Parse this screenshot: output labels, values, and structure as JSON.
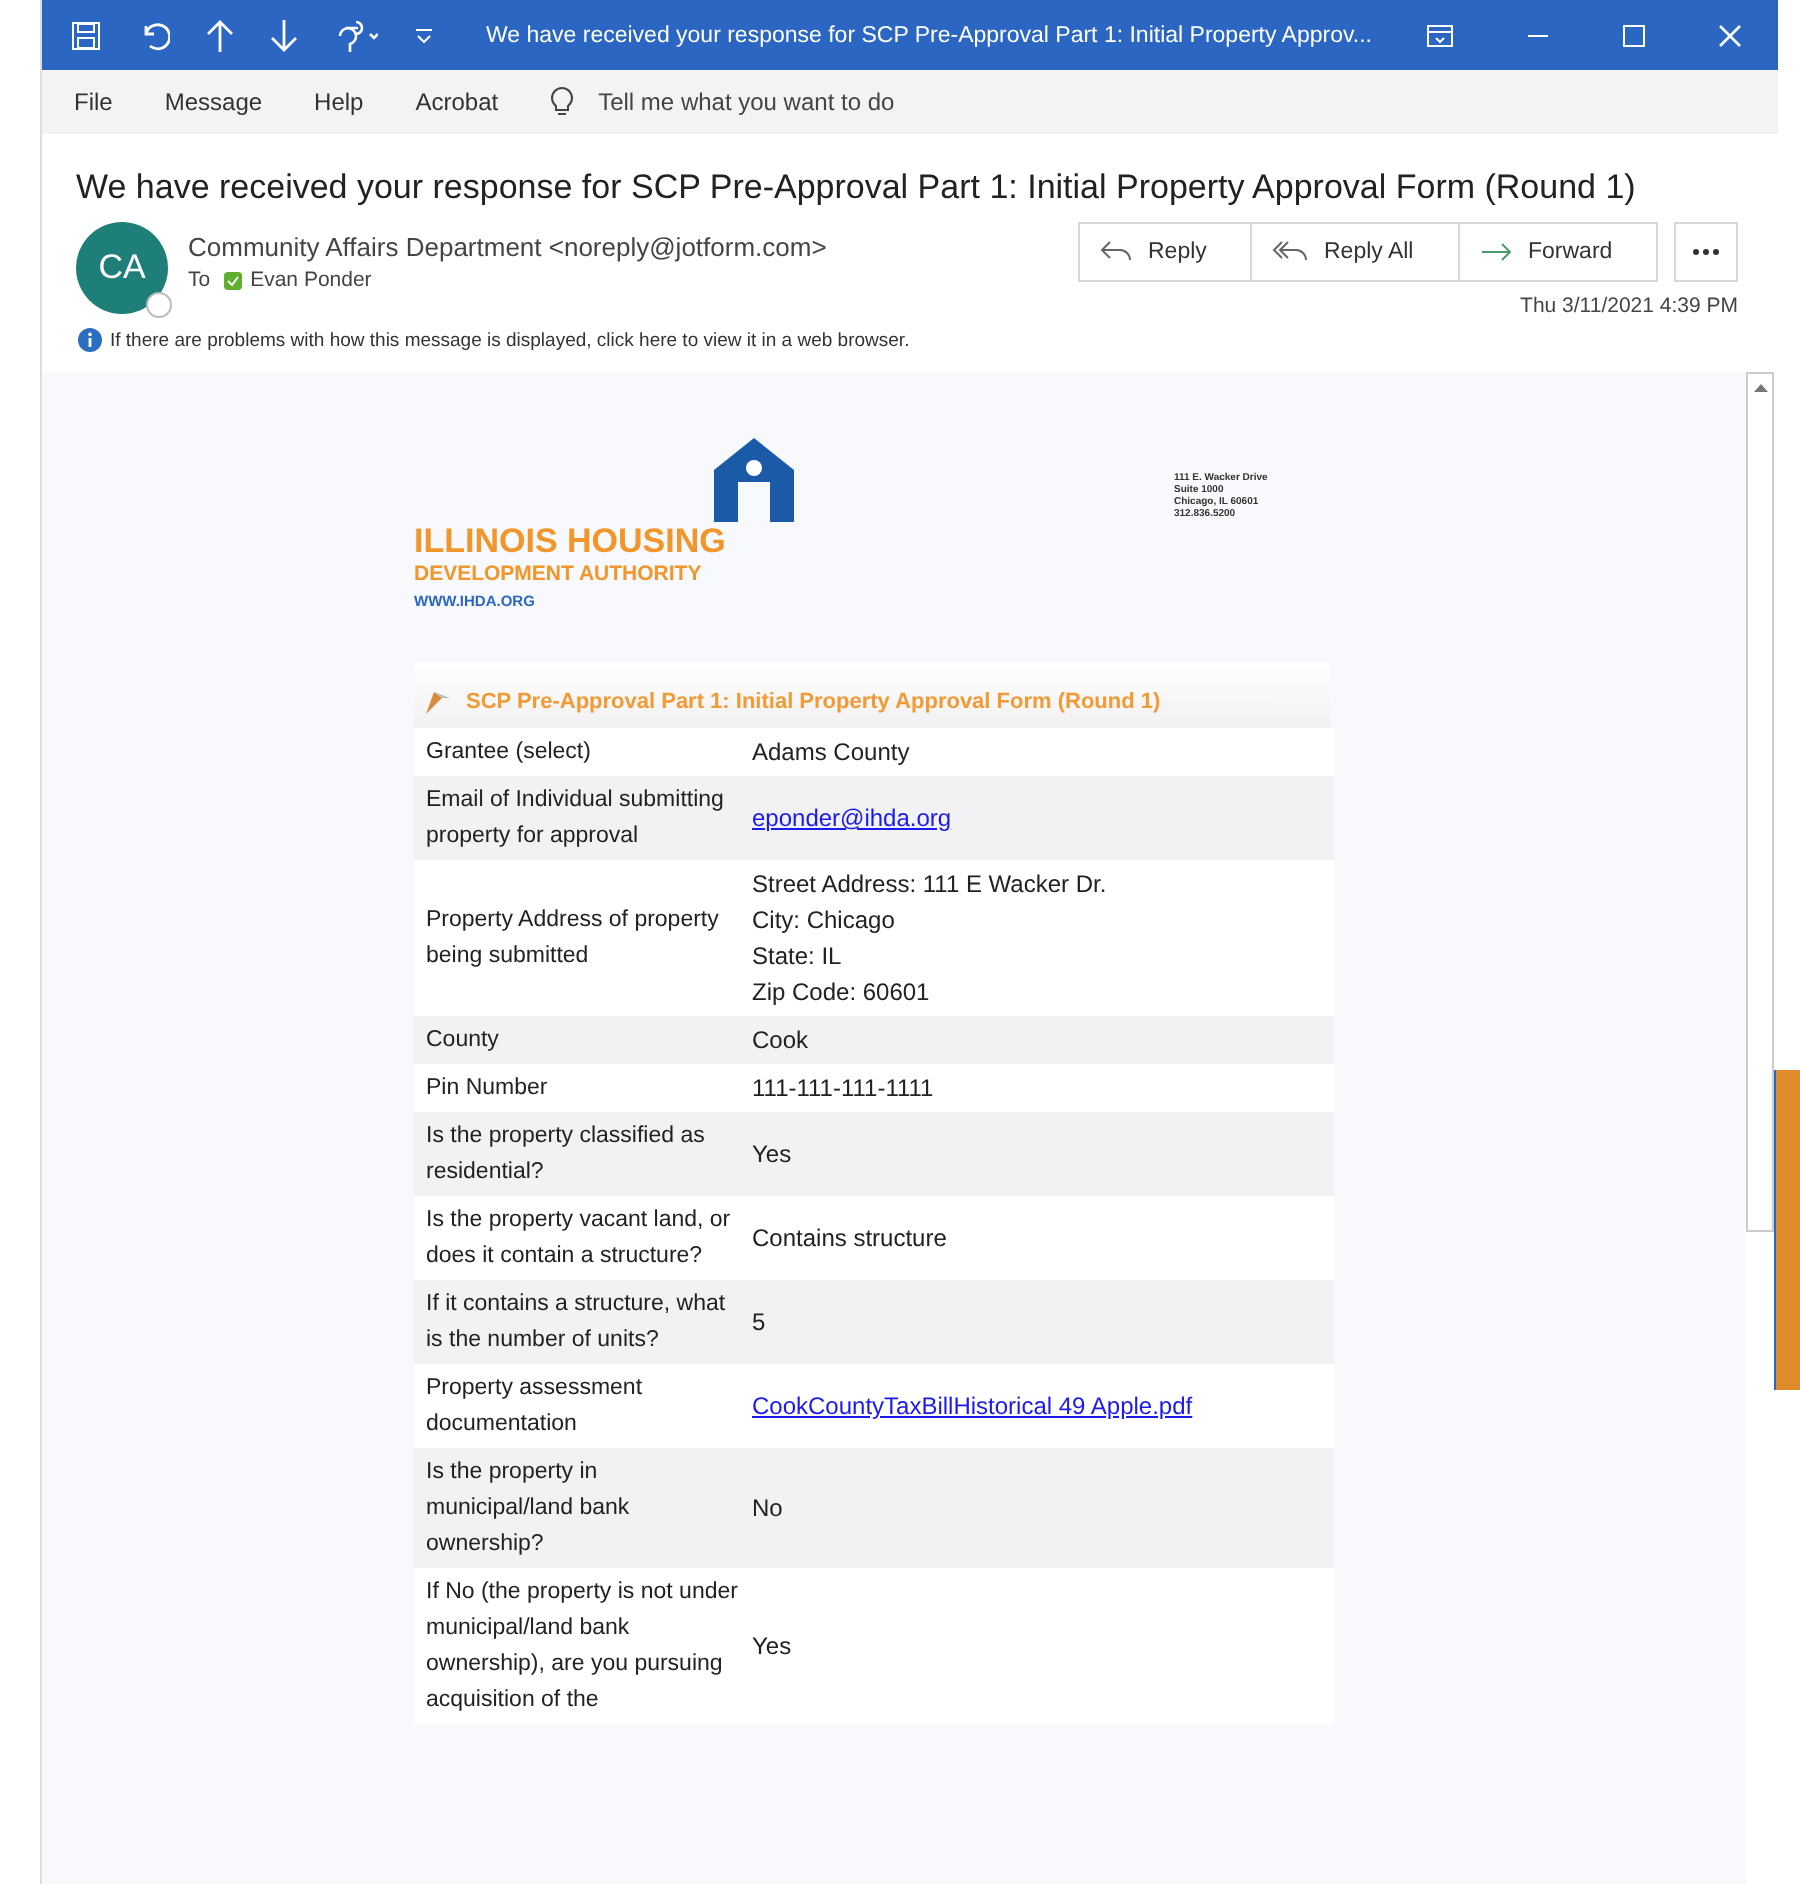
{
  "window": {
    "title": "We have received your response for SCP Pre-Approval Part 1: Initial Property Approv..."
  },
  "menu": [
    "File",
    "Message",
    "Help",
    "Acrobat"
  ],
  "tell_me": {
    "placeholder": "Tell me what you want to do"
  },
  "message": {
    "subject": "We have received your response for SCP Pre-Approval Part 1: Initial Property Approval Form (Round 1)",
    "avatar": "CA",
    "from": "Community Affairs Department <noreply@jotform.com>",
    "to_label": "To",
    "to": "Evan Ponder",
    "date": "Thu 3/11/2021 4:39 PM",
    "actions": [
      "Reply",
      "Reply All",
      "Forward"
    ],
    "info": "If there are problems with how this message is displayed, click here to view it in a web browser."
  },
  "letterhead": {
    "name": "ILLINOIS HOUSING",
    "name2": "DEVELOPMENT AUTHORITY",
    "url": "WWW.IHDA.ORG",
    "address": [
      "111 E. Wacker Drive",
      "Suite 1000",
      "Chicago, IL 60601",
      "312.836.5200"
    ]
  },
  "form": {
    "title": "SCP Pre-Approval Part 1: Initial Property Approval Form (Round 1)",
    "rows": [
      {
        "label": "Grantee (select)",
        "kind": "text",
        "value": [
          "Adams County"
        ]
      },
      {
        "label": "Email of Individual submitting property for approval",
        "kind": "link",
        "value": [
          "eponder@ihda.org"
        ]
      },
      {
        "label": "Property Address of property being submitted",
        "kind": "text",
        "value": [
          "Street Address: 111 E Wacker Dr.",
          "City: Chicago",
          "State: IL",
          "Zip Code: 60601"
        ]
      },
      {
        "label": "County",
        "kind": "text",
        "value": [
          "Cook"
        ]
      },
      {
        "label": "Pin Number",
        "kind": "text",
        "value": [
          "111-111-111-1111"
        ]
      },
      {
        "label": "Is the property classified as residential?",
        "kind": "text",
        "value": [
          "Yes"
        ]
      },
      {
        "label": "Is the property vacant land, or does it contain a structure?",
        "kind": "text",
        "value": [
          "Contains structure"
        ]
      },
      {
        "label": "If it contains a structure, what is the number of units?",
        "kind": "text",
        "value": [
          "5"
        ]
      },
      {
        "label": "Property assessment documentation",
        "kind": "link",
        "value": [
          "CookCountyTaxBillHistorical 49 Apple.pdf"
        ]
      },
      {
        "label": "Is the property in municipal/land bank ownership?",
        "kind": "text",
        "value": [
          "No"
        ]
      },
      {
        "label": "If No (the property is not under municipal/land bank ownership), are you pursuing acquisition of the",
        "kind": "text",
        "value": [
          "Yes"
        ]
      }
    ]
  }
}
